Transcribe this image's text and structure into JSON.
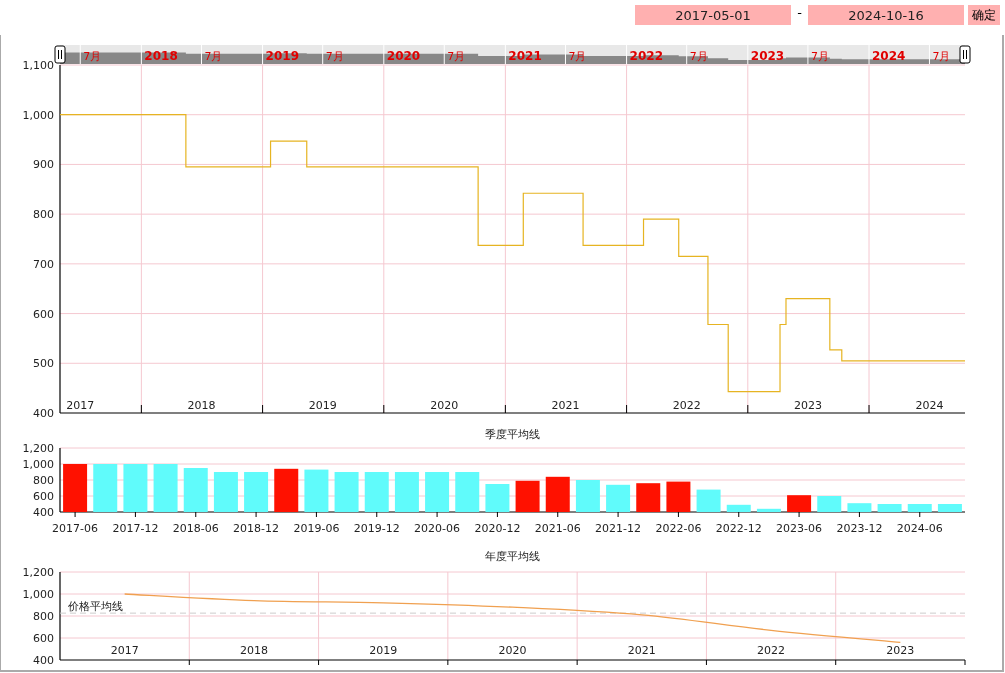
{
  "date_range": {
    "start": "2017-05-01",
    "separator": "-",
    "end": "2024-10-16",
    "confirm_button": "确定"
  },
  "navigator": {
    "labels": [
      {
        "kind": "month",
        "text": "7月"
      },
      {
        "kind": "year",
        "text": "2018"
      },
      {
        "kind": "month",
        "text": "7月"
      },
      {
        "kind": "year",
        "text": "2019"
      },
      {
        "kind": "month",
        "text": "7月"
      },
      {
        "kind": "year",
        "text": "2020"
      },
      {
        "kind": "month",
        "text": "7月"
      },
      {
        "kind": "year",
        "text": "2021"
      },
      {
        "kind": "month",
        "text": "7月"
      },
      {
        "kind": "year",
        "text": "2022"
      },
      {
        "kind": "month",
        "text": "7月"
      },
      {
        "kind": "year",
        "text": "2023"
      },
      {
        "kind": "month",
        "text": "7月"
      },
      {
        "kind": "year",
        "text": "2024"
      },
      {
        "kind": "month",
        "text": "7月"
      }
    ]
  },
  "price_chart": {
    "chart_data": {
      "type": "line",
      "grid": true,
      "xlim": [
        "2017-05-01",
        "2024-10-16"
      ],
      "ylim": [
        400,
        1100
      ],
      "x": [
        "2017-05-01",
        "2018-05-15",
        "2018-05-15",
        "2019-01-25",
        "2019-01-25",
        "2019-05-14",
        "2019-05-14",
        "2020-10-11",
        "2020-10-11",
        "2021-02-24",
        "2021-02-24",
        "2021-08-23",
        "2021-08-23",
        "2022-02-21",
        "2022-02-21",
        "2022-06-07",
        "2022-06-07",
        "2022-09-03",
        "2022-09-03",
        "2022-11-03",
        "2022-11-03",
        "2023-04-08",
        "2023-04-08",
        "2023-04-26",
        "2023-04-26",
        "2023-09-05",
        "2023-09-05",
        "2023-10-11",
        "2023-10-11",
        "2024-10-16"
      ],
      "series": [
        {
          "color": "#e6b422",
          "values": [
            1000,
            1000,
            895,
            895,
            947,
            947,
            895,
            895,
            737,
            737,
            842,
            842,
            737,
            737,
            790,
            790,
            715,
            715,
            578,
            578,
            443,
            443,
            578,
            578,
            630,
            630,
            527,
            527,
            505,
            505
          ]
        }
      ],
      "yticks": [
        {
          "value": 400,
          "label": "400"
        },
        {
          "value": 500,
          "label": "500"
        },
        {
          "value": 600,
          "label": "600"
        },
        {
          "value": 700,
          "label": "700"
        },
        {
          "value": 800,
          "label": "800"
        },
        {
          "value": 900,
          "label": "900"
        },
        {
          "value": 1000,
          "label": "1,000"
        },
        {
          "value": 1100,
          "label": "1,100"
        }
      ],
      "xticks": [
        {
          "value": "2017-07-01",
          "label": "2017"
        },
        {
          "value": "2018-07-01",
          "label": "2018"
        },
        {
          "value": "2019-07-01",
          "label": "2019"
        },
        {
          "value": "2020-07-01",
          "label": "2020"
        },
        {
          "value": "2021-07-01",
          "label": "2021"
        },
        {
          "value": "2022-07-01",
          "label": "2022"
        },
        {
          "value": "2023-07-01",
          "label": "2023"
        },
        {
          "value": "2024-07-01",
          "label": "2024"
        }
      ]
    }
  },
  "quarterly_chart": {
    "chart_data": {
      "type": "bar",
      "title": "季度平均线",
      "grid": true,
      "ylim": [
        400,
        1200
      ],
      "categories": [
        "2017-06",
        null,
        "2017-12",
        null,
        "2018-06",
        null,
        "2018-12",
        null,
        "2019-06",
        null,
        "2019-12",
        null,
        "2020-06",
        null,
        "2020-12",
        null,
        "2021-06",
        null,
        "2021-12",
        null,
        "2022-06",
        null,
        "2022-12",
        null,
        "2023-06",
        null,
        "2023-12",
        null,
        "2024-06",
        null
      ],
      "series": [
        {
          "values": [
            1000,
            1000,
            1000,
            1000,
            950,
            900,
            900,
            940,
            930,
            900,
            900,
            900,
            900,
            900,
            750,
            790,
            840,
            800,
            740,
            760,
            780,
            680,
            490,
            440,
            610,
            600,
            510,
            500,
            500,
            500
          ]
        }
      ],
      "yticks": [
        {
          "value": 400,
          "label": "400"
        },
        {
          "value": 600,
          "label": "600"
        },
        {
          "value": 800,
          "label": "800"
        },
        {
          "value": 1000,
          "label": "1,000"
        },
        {
          "value": 1200,
          "label": "1,200"
        }
      ]
    }
  },
  "annual_chart": {
    "chart_data": {
      "type": "line",
      "title": "年度平均线",
      "grid": true,
      "ylim": [
        400,
        1200
      ],
      "categories": [
        "2017",
        "2018",
        "2019",
        "2020",
        "2021",
        "2022",
        "2023"
      ],
      "series": [
        {
          "color": "#f0a050",
          "values": [
            1000,
            940,
            920,
            880,
            810,
            670,
            560
          ]
        }
      ],
      "yticks": [
        {
          "value": 400,
          "label": "400"
        },
        {
          "value": 600,
          "label": "600"
        },
        {
          "value": 800,
          "label": "800"
        },
        {
          "value": 1000,
          "label": "1,000"
        },
        {
          "value": 1200,
          "label": "1,200"
        }
      ],
      "ref_lines": [
        {
          "axis": "y",
          "value": 826,
          "label": "价格平均线"
        }
      ]
    }
  }
}
